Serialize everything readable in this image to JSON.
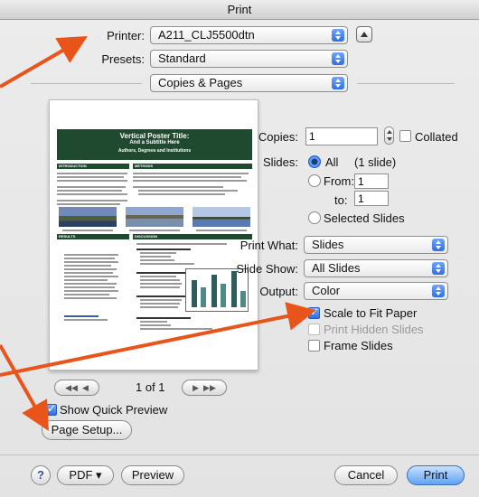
{
  "window": {
    "title": "Print"
  },
  "printer": {
    "label": "Printer:",
    "value": "A211_CLJ5500dtn"
  },
  "presets": {
    "label": "Presets:",
    "value": "Standard"
  },
  "section": {
    "value": "Copies & Pages"
  },
  "copies": {
    "label": "Copies:",
    "value": "1",
    "collated_label": "Collated"
  },
  "slides": {
    "label": "Slides:",
    "all_label": "All",
    "all_count": "(1 slide)",
    "from_label": "From:",
    "from_value": "1",
    "to_label": "to:",
    "to_value": "1",
    "selected_label": "Selected Slides",
    "selected_option": "All"
  },
  "print_what": {
    "label": "Print What:",
    "value": "Slides"
  },
  "slide_show": {
    "label": "Slide Show:",
    "value": "All Slides"
  },
  "output": {
    "label": "Output:",
    "value": "Color"
  },
  "options": {
    "scale_label": "Scale to Fit Paper",
    "scale_checked": true,
    "hidden_label": "Print Hidden Slides",
    "hidden_enabled": false,
    "frame_label": "Frame Slides",
    "frame_checked": false
  },
  "preview": {
    "poster_title": "Vertical Poster Title:",
    "poster_subtitle": "And a Subtitle Here",
    "poster_authors": "Authors, Degrees and Institutions",
    "section_introduction": "INTRODUCTION",
    "section_methods": "METHODS",
    "section_results": "RESULTS",
    "section_discussion": "DISCUSSION",
    "page_indicator": "1 of 1",
    "first_label": "◀◀",
    "prev_label": "◀",
    "next_label": "▶",
    "last_label": "▶▶"
  },
  "quick_preview": {
    "label": "Show Quick Preview",
    "checked": true
  },
  "buttons": {
    "page_setup": "Page Setup...",
    "help": "?",
    "pdf": "PDF ▾",
    "preview": "Preview",
    "cancel": "Cancel",
    "print": "Print"
  },
  "icons": {
    "popup": "popup-stepper-icon",
    "disclosure": "disclosure-triangle-icon",
    "help": "question-mark-icon"
  },
  "colors": {
    "annotation_arrow": "#e8541a",
    "poster_green": "#1f4a2f",
    "accent_blue": "#2f6fe0"
  }
}
